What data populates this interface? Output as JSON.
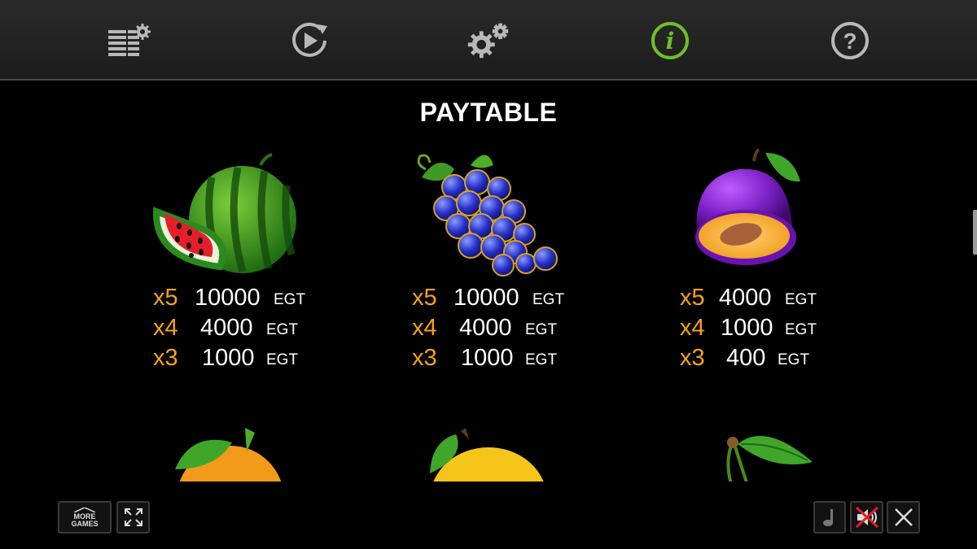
{
  "menu": {
    "items": [
      {
        "icon": "bet-settings-icon",
        "active": false
      },
      {
        "icon": "autoplay-icon",
        "active": false
      },
      {
        "icon": "settings-gears-icon",
        "active": false
      },
      {
        "icon": "info-icon",
        "active": true
      },
      {
        "icon": "help-icon",
        "active": false
      }
    ],
    "active_color": "#6fbf2a",
    "icon_color": "#b8b8b8"
  },
  "title": "PAYTABLE",
  "colors": {
    "multiplier": "#f5a21b",
    "amount": "#ffffff"
  },
  "symbols": [
    {
      "name": "watermelon",
      "pays": [
        {
          "mult": "x5",
          "amount": "10000",
          "currency": "EGT"
        },
        {
          "mult": "x4",
          "amount": "4000",
          "currency": "EGT"
        },
        {
          "mult": "x3",
          "amount": "1000",
          "currency": "EGT"
        }
      ]
    },
    {
      "name": "grapes",
      "pays": [
        {
          "mult": "x5",
          "amount": "10000",
          "currency": "EGT"
        },
        {
          "mult": "x4",
          "amount": "4000",
          "currency": "EGT"
        },
        {
          "mult": "x3",
          "amount": "1000",
          "currency": "EGT"
        }
      ]
    },
    {
      "name": "plum",
      "pays": [
        {
          "mult": "x5",
          "amount": "4000",
          "currency": "EGT"
        },
        {
          "mult": "x4",
          "amount": "1000",
          "currency": "EGT"
        },
        {
          "mult": "x3",
          "amount": "400",
          "currency": "EGT"
        }
      ]
    }
  ],
  "next_row_symbols": [
    "orange",
    "lemon",
    "cherry"
  ],
  "bottom": {
    "more_games_line1": "MORE",
    "more_games_line2": "GAMES",
    "fullscreen_icon": "fullscreen-icon",
    "music_icon": "music-note-icon",
    "sound_icon": "sound-muted-icon",
    "close_icon": "close-icon"
  }
}
